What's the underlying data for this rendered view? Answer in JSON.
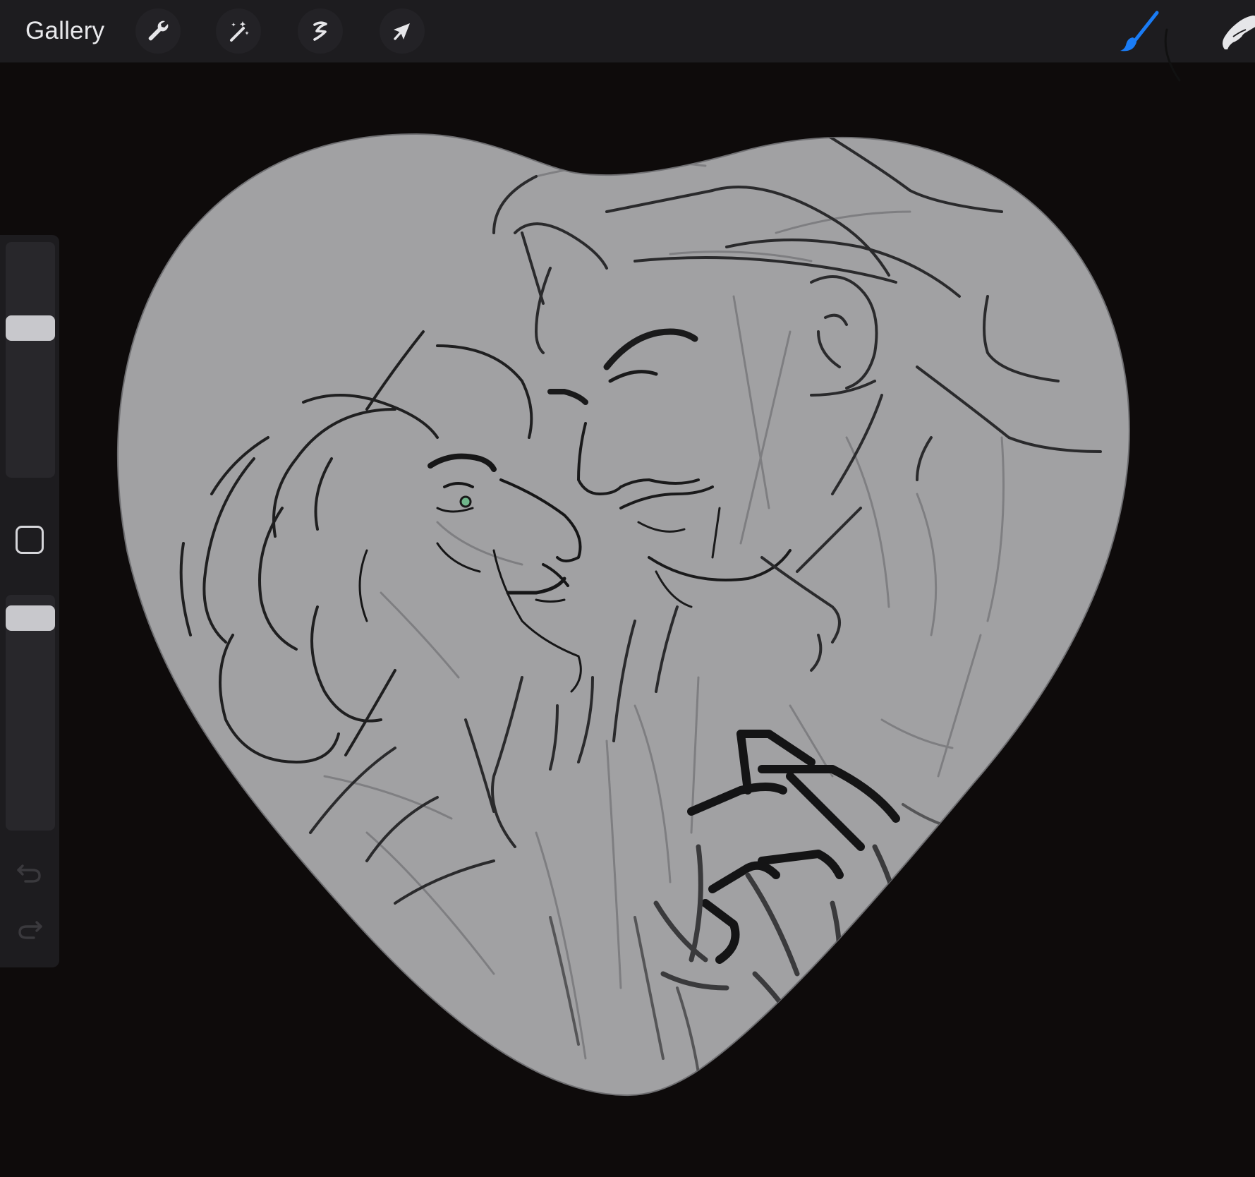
{
  "toolbar": {
    "gallery_label": "Gallery",
    "left_tools": [
      {
        "name": "actions",
        "icon": "wrench-icon"
      },
      {
        "name": "adjustments",
        "icon": "magic-wand-icon"
      },
      {
        "name": "selection",
        "icon": "selection-s-icon"
      },
      {
        "name": "transform",
        "icon": "arrow-cursor-icon"
      }
    ],
    "right_tools": [
      {
        "name": "brush",
        "icon": "brush-icon",
        "active": true
      },
      {
        "name": "smudge",
        "icon": "smudge-finger-icon",
        "active": false
      }
    ],
    "active_color": "#1a7cf5"
  },
  "sidebar": {
    "brush_size_level": 0.65,
    "opacity_level": 0.95,
    "modify_icon": "square-modify-icon",
    "undo_icon": "undo-arrow-icon",
    "redo_icon": "redo-arrow-icon"
  },
  "canvas": {
    "background_color": "#0e0b0b",
    "shape_fill": "#a1a1a3",
    "shape": "heart"
  }
}
